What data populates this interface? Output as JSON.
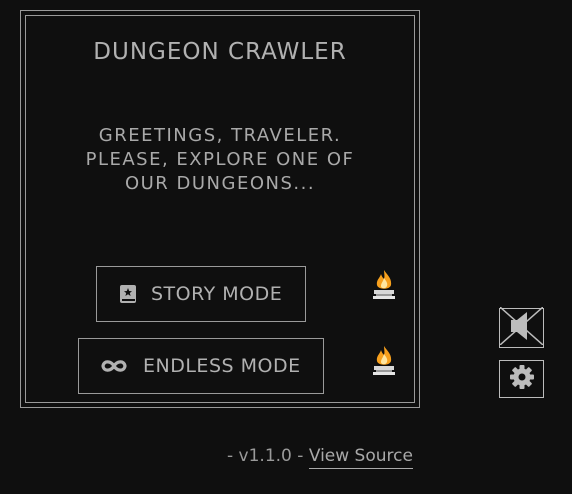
{
  "menu": {
    "title": "DUNGEON CRAWLER",
    "greeting_line1": "GREETINGS, TRAVELER.",
    "greeting_line2": "PLEASE, EXPLORE ONE OF",
    "greeting_line3": "OUR DUNGEONS...",
    "story_label": "STORY MODE",
    "endless_label": "ENDLESS MODE"
  },
  "footer": {
    "version": "- v1.1.0 -",
    "source_link": "View Source"
  },
  "icons": {
    "story": "book-icon",
    "endless": "infinity-icon",
    "torch": "fire-brazier-icon",
    "mute": "sound-muted-icon",
    "settings": "gear-icon"
  },
  "colors": {
    "background": "#0f0f0f",
    "text": "#a9a9a9",
    "border": "#9a9a9a",
    "flame": "#f7a01d"
  }
}
